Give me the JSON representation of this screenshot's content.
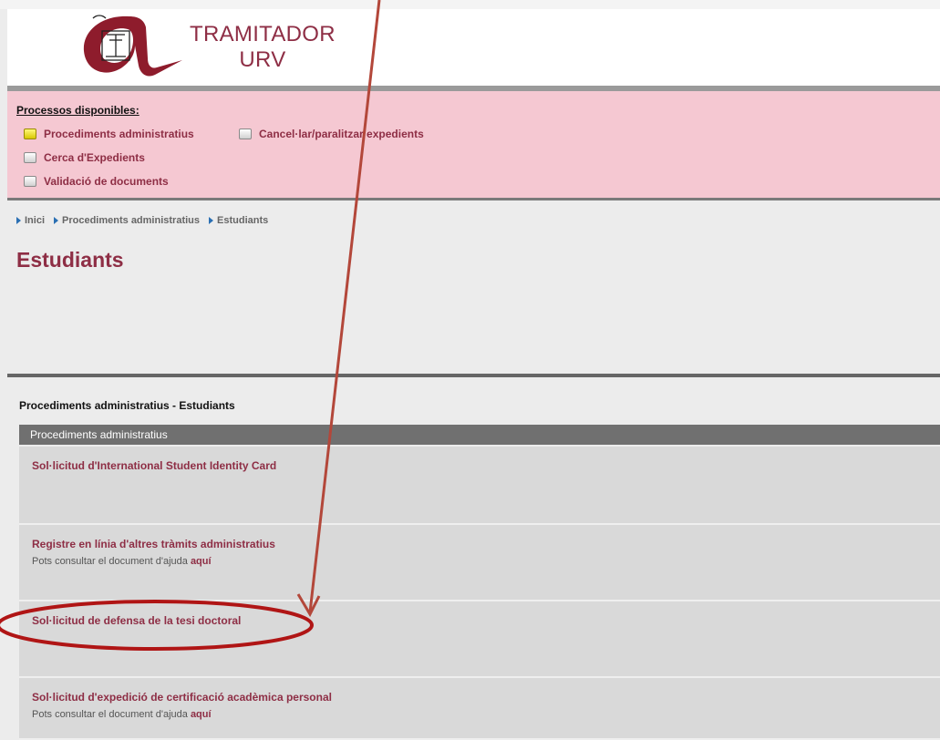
{
  "header": {
    "logo_icon": "urv-logo-icon",
    "brand_line1": "TRAMITADOR",
    "brand_line2": "URV",
    "brand_color": "#8e2e45"
  },
  "menu": {
    "title": "Processos disponibles:",
    "items": [
      {
        "label": "Procediments administratius",
        "active": true
      },
      {
        "label": "Cancel·lar/paralitzar expedients",
        "active": false
      },
      {
        "label": "Cerca d'Expedients",
        "active": false
      },
      {
        "label": "Validació de documents",
        "active": false
      }
    ],
    "background": "#f5c8d2"
  },
  "breadcrumb": [
    "Inici",
    "Procediments administratius",
    "Estudiants"
  ],
  "page_title": "Estudiants",
  "section_heading": "Procediments administratius - Estudiants",
  "table": {
    "header": "Procediments administratius",
    "rows": [
      {
        "title": "Sol·licitud d'International Student Identity Card",
        "note": "",
        "link": ""
      },
      {
        "title": "Registre en línia d'altres tràmits administratius",
        "note": "Pots consultar el document d'ajuda",
        "link": "aquí"
      },
      {
        "title": "Sol·licitud de defensa de la tesi doctoral",
        "note": "",
        "link": ""
      },
      {
        "title": "Sol·licitud d'expedició de certificació acadèmica personal",
        "note": "Pots consultar el document d'ajuda",
        "link": "aquí"
      }
    ]
  },
  "annotation": {
    "color": "#b01515",
    "arrow_icon": "annotation-arrow",
    "ellipse_icon": "annotation-ellipse"
  }
}
